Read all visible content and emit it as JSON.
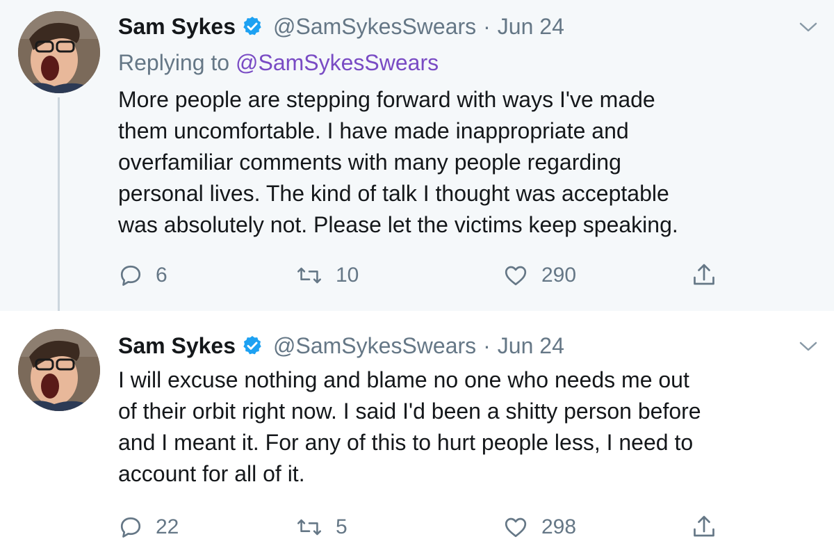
{
  "tweets": [
    {
      "author": "Sam Sykes",
      "handle": "@SamSykesSwears",
      "separator": "·",
      "date": "Jun 24",
      "replying_prefix": "Replying to",
      "replying_to": "@SamSykesSwears",
      "text_lines": [
        "More people are stepping forward with ways I've made",
        "them uncomfortable. I have made inappropriate and",
        "overfamiliar comments with many people regarding",
        "personal lives. The kind of talk I thought was acceptable",
        "was absolutely not. Please let the victims keep speaking."
      ],
      "replies": "6",
      "retweets": "10",
      "likes": "290"
    },
    {
      "author": "Sam Sykes",
      "handle": "@SamSykesSwears",
      "separator": "·",
      "date": "Jun 24",
      "text_lines": [
        "I will excuse nothing and blame no one who needs me out",
        "of their orbit right now. I said I'd been a shitty person before",
        "and I meant it. For any of this to hurt people less, I need to",
        "account for all of it."
      ],
      "replies": "22",
      "retweets": "5",
      "likes": "298"
    }
  ],
  "icons": {
    "avatar": "avatar",
    "verified": "verified-badge-icon",
    "caret": "chevron-down-icon",
    "reply": "reply-icon",
    "retweet": "retweet-icon",
    "like": "heart-icon",
    "share": "share-icon"
  },
  "colors": {
    "thread_bg": "#f5f8fa",
    "verified": "#1da1f2",
    "secondary_text": "#657786",
    "mention": "#794bc4"
  }
}
